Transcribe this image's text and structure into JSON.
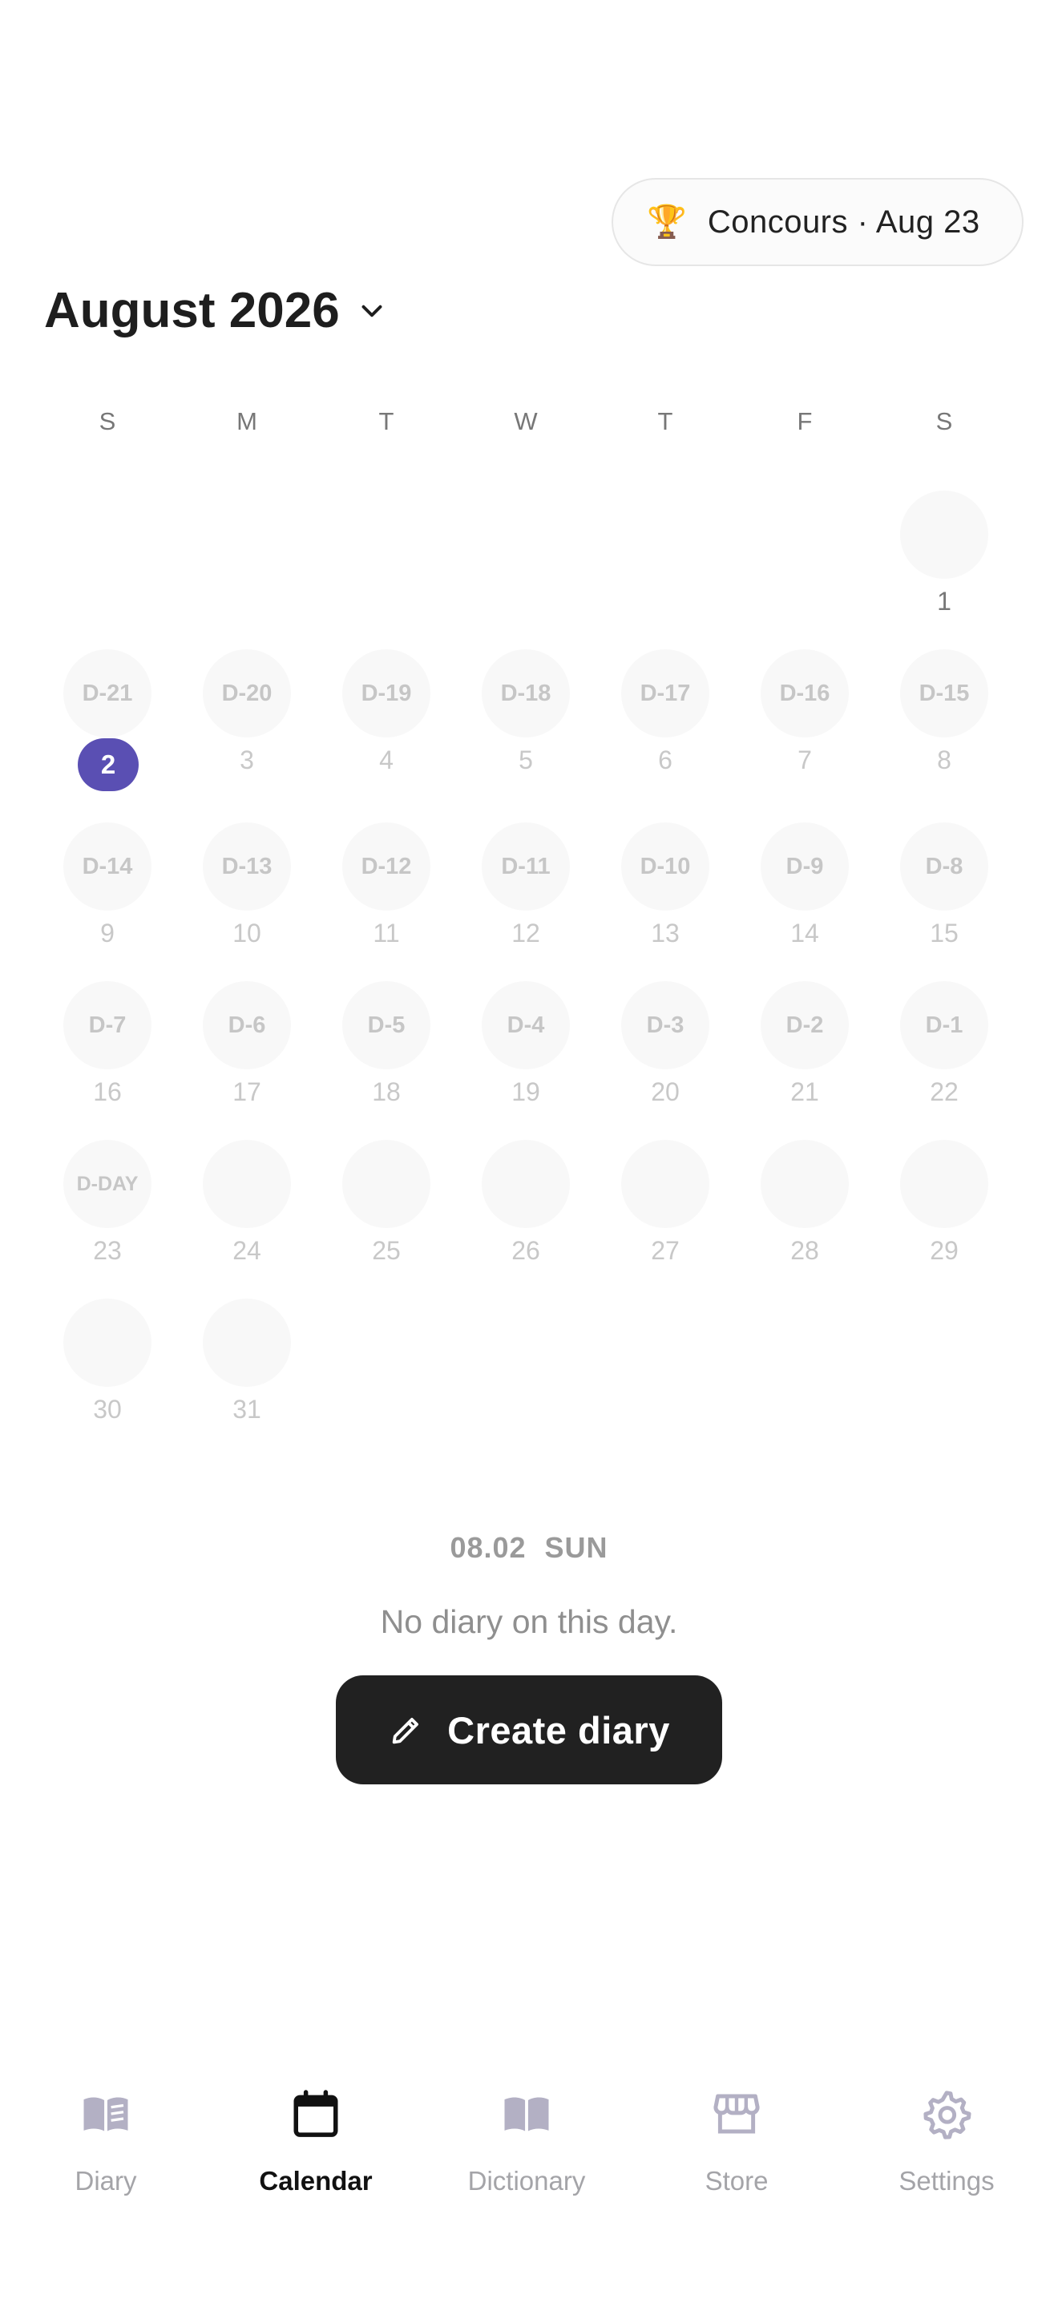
{
  "event": {
    "icon": "🏆",
    "label": "Concours · Aug 23"
  },
  "header": {
    "month_title": "August 2026"
  },
  "weekdays": [
    "S",
    "M",
    "T",
    "W",
    "T",
    "F",
    "S"
  ],
  "calendar": {
    "today": "2",
    "days": {
      "1": "1",
      "2": "2",
      "3": "3",
      "4": "4",
      "5": "5",
      "6": "6",
      "7": "7",
      "8": "8",
      "9": "9",
      "10": "10",
      "11": "11",
      "12": "12",
      "13": "13",
      "14": "14",
      "15": "15",
      "16": "16",
      "17": "17",
      "18": "18",
      "19": "19",
      "20": "20",
      "21": "21",
      "22": "22",
      "23": "23",
      "24": "24",
      "25": "25",
      "26": "26",
      "27": "27",
      "28": "28",
      "29": "29",
      "30": "30",
      "31": "31"
    },
    "dday": {
      "2": "D-21",
      "3": "D-20",
      "4": "D-19",
      "5": "D-18",
      "6": "D-17",
      "7": "D-16",
      "8": "D-15",
      "9": "D-14",
      "10": "D-13",
      "11": "D-12",
      "12": "D-11",
      "13": "D-10",
      "14": "D-9",
      "15": "D-8",
      "16": "D-7",
      "17": "D-6",
      "18": "D-5",
      "19": "D-4",
      "20": "D-3",
      "21": "D-2",
      "22": "D-1",
      "23": "D-DAY"
    }
  },
  "selected": {
    "date": "08.02",
    "weekday": "SUN",
    "empty_message": "No diary on this day."
  },
  "create_button": {
    "label": "Create diary",
    "icon": "pencil-icon"
  },
  "nav": [
    {
      "label": "Diary",
      "icon": "book-open-icon"
    },
    {
      "label": "Calendar",
      "icon": "calendar-icon"
    },
    {
      "label": "Dictionary",
      "icon": "dictionary-icon"
    },
    {
      "label": "Store",
      "icon": "store-icon"
    },
    {
      "label": "Settings",
      "icon": "gear-icon"
    }
  ],
  "colors": {
    "accent": "#5a4fb3",
    "button": "#212121",
    "muted": "#c8c8c8"
  }
}
